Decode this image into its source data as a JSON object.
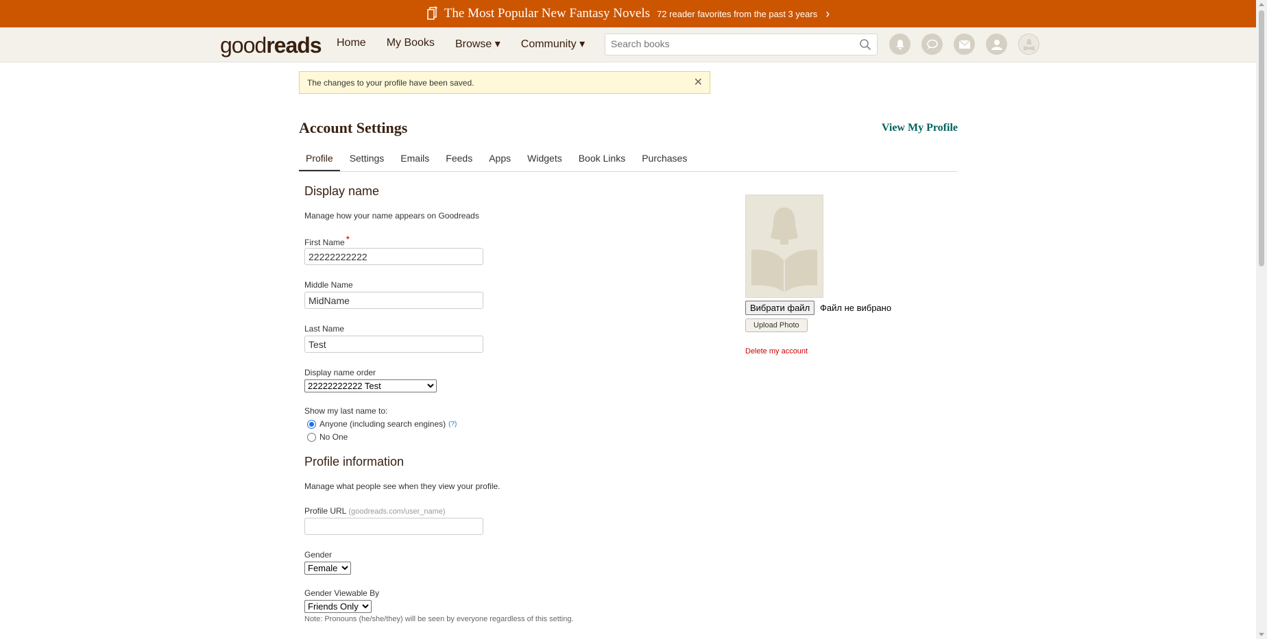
{
  "promo": {
    "title": "The Most Popular New Fantasy Novels",
    "subtitle": "72 reader favorites from the past 3 years",
    "bg_color": "#cc5500"
  },
  "header": {
    "logo_light": "good",
    "logo_bold": "reads",
    "nav": [
      "Home",
      "My Books",
      "Browse ▾",
      "Community ▾"
    ],
    "search_placeholder": "Search books",
    "icons": [
      "bell-icon",
      "discussion-icon",
      "mail-icon",
      "friends-icon",
      "avatar"
    ]
  },
  "alert": {
    "message": "The changes to your profile have been saved.",
    "close": "✕"
  },
  "settings": {
    "title": "Account Settings",
    "view_profile": "View My Profile",
    "tabs": [
      "Profile",
      "Settings",
      "Emails",
      "Feeds",
      "Apps",
      "Widgets",
      "Book Links",
      "Purchases"
    ],
    "active_tab": "Profile"
  },
  "display_name": {
    "title": "Display name",
    "desc": "Manage how your name appears on Goodreads",
    "first_name_label": "First Name",
    "required_mark": "*",
    "first_name_value": "22222222222",
    "middle_name_label": "Middle Name",
    "middle_name_value": "MidName",
    "last_name_label": "Last Name",
    "last_name_value": "Test",
    "order_label": "Display name order",
    "order_value": "22222222222 Test",
    "show_last_label": "Show my last name to:",
    "opt_anyone": "Anyone (including search engines)",
    "opt_anyone_help": "(?)",
    "opt_none": "No One"
  },
  "profile_info": {
    "title": "Profile information",
    "desc": "Manage what people see when they view your profile.",
    "url_label": "Profile URL",
    "url_hint": "(goodreads.com/user_name)",
    "url_value": "",
    "gender_label": "Gender",
    "gender_value": "Female",
    "gender_viewable_label": "Gender Viewable By",
    "gender_viewable_value": "Friends Only",
    "note": "Note: Pronouns (he/she/they) will be seen by everyone regardless of this setting."
  },
  "photo": {
    "choose_file": "Вибрати файл",
    "no_file": "Файл не вибрано",
    "upload": "Upload Photo",
    "delete": "Delete my account"
  }
}
